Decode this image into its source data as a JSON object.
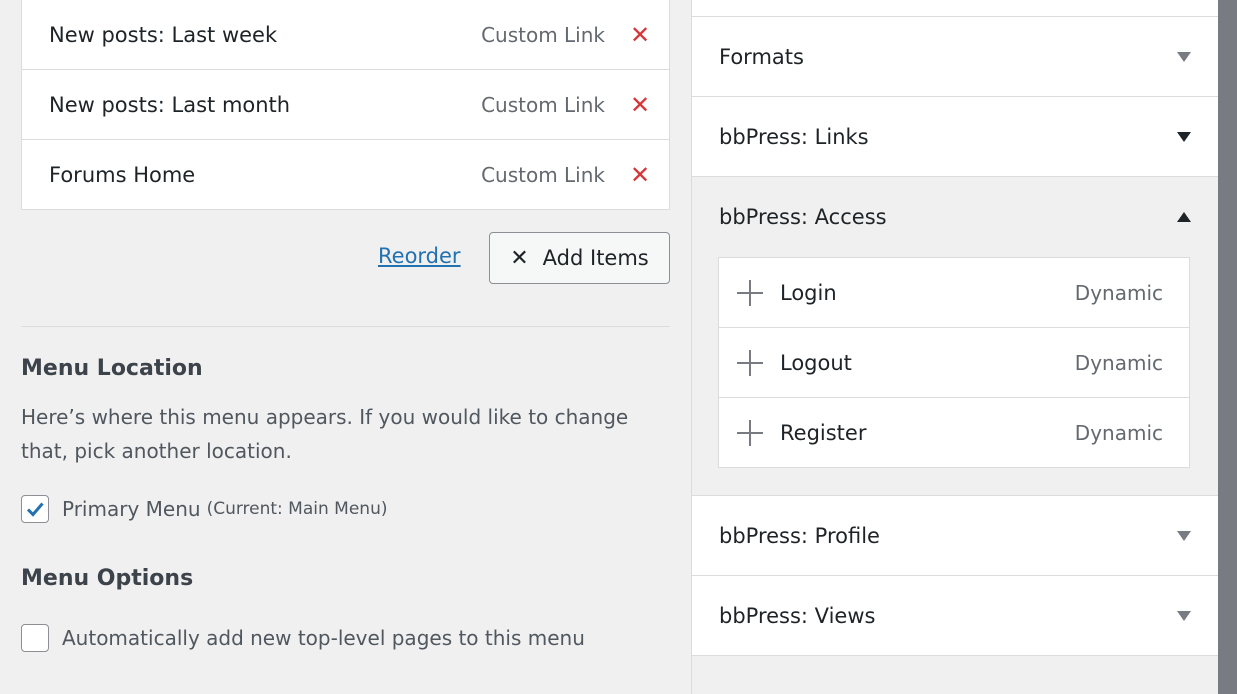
{
  "menu_items": [
    {
      "title": "New posts: Last week",
      "type": "Custom Link"
    },
    {
      "title": "New posts: Last month",
      "type": "Custom Link"
    },
    {
      "title": "Forums Home",
      "type": "Custom Link"
    }
  ],
  "remove_glyph": "✕",
  "actions": {
    "reorder_label": "Reorder",
    "add_items_label": "Add Items",
    "add_items_glyph": "✕"
  },
  "menu_location": {
    "title": "Menu Location",
    "description": "Here’s where this menu appears. If you would like to change that, pick another location.",
    "primary_label": "Primary Menu",
    "primary_current": "(Current: Main Menu)",
    "primary_checked": true
  },
  "menu_options": {
    "title": "Menu Options",
    "auto_add_label": "Automatically add new top-level pages to this menu",
    "auto_add_checked": false
  },
  "accordion": {
    "formats": "Formats",
    "bbpress_links": "bbPress: Links",
    "bbpress_access": "bbPress: Access",
    "access_items": [
      {
        "name": "Login",
        "kind": "Dynamic"
      },
      {
        "name": "Logout",
        "kind": "Dynamic"
      },
      {
        "name": "Register",
        "kind": "Dynamic"
      }
    ],
    "bbpress_profile": "bbPress: Profile",
    "bbpress_views": "bbPress: Views"
  },
  "colors": {
    "link": "#2271b1",
    "remove": "#d63638",
    "check": "#2271b1"
  }
}
